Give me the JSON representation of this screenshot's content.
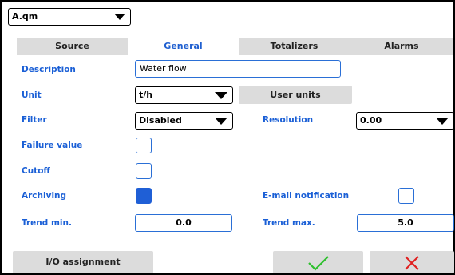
{
  "header": {
    "selector_value": "A.qm"
  },
  "tabs": [
    {
      "label": "Source"
    },
    {
      "label": "General"
    },
    {
      "label": "Totalizers"
    },
    {
      "label": "Alarms"
    }
  ],
  "active_tab": "General",
  "form": {
    "description": {
      "label": "Description",
      "value": "Water flow"
    },
    "unit": {
      "label": "Unit",
      "value": "t/h",
      "user_units_button": "User units"
    },
    "filter": {
      "label": "Filter",
      "value": "Disabled"
    },
    "resolution": {
      "label": "Resolution",
      "value": "0.00"
    },
    "failure_value": {
      "label": "Failure value",
      "checked": false
    },
    "cutoff": {
      "label": "Cutoff",
      "checked": false
    },
    "archiving": {
      "label": "Archiving",
      "checked": true
    },
    "email_notification": {
      "label": "E-mail notification",
      "checked": false
    },
    "trend_min": {
      "label": "Trend min.",
      "value": "0.0"
    },
    "trend_max": {
      "label": "Trend max.",
      "value": "5.0"
    }
  },
  "footer": {
    "io_assignment": "I/O assignment",
    "confirm_icon": "check-icon",
    "cancel_icon": "close-icon"
  },
  "colors": {
    "label_blue": "#1a5fd6",
    "checked_blue": "#1f5fd6",
    "button_gray": "#dcdcdc",
    "confirm_green": "#2ec02e",
    "cancel_red": "#e02020"
  }
}
